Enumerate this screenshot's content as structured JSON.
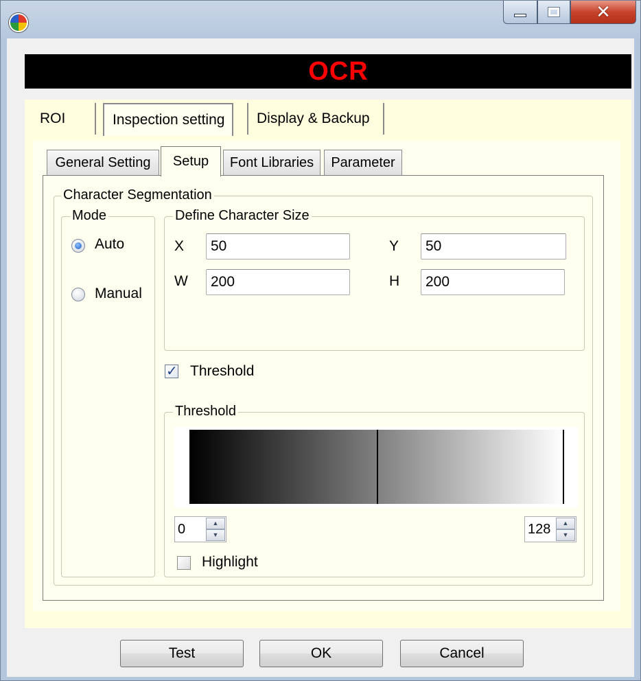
{
  "header": {
    "title": "OCR"
  },
  "top_tabs": [
    {
      "label": "ROI"
    },
    {
      "label": "Inspection setting"
    },
    {
      "label": "Display & Backup"
    }
  ],
  "sub_tabs": [
    {
      "label": "General Setting"
    },
    {
      "label": "Setup"
    },
    {
      "label": "Font Libraries"
    },
    {
      "label": "Parameter"
    }
  ],
  "segmentation": {
    "title": "Character Segmentation",
    "mode": {
      "title": "Mode",
      "options": [
        {
          "label": "Auto",
          "checked": true
        },
        {
          "label": "Manual",
          "checked": false
        }
      ]
    },
    "size": {
      "title": "Define Character Size",
      "x_label": "X",
      "x_value": "50",
      "y_label": "Y",
      "y_value": "50",
      "w_label": "W",
      "w_value": "200",
      "h_label": "H",
      "h_value": "200"
    },
    "threshold_checkbox": {
      "label": "Threshold",
      "checked": true
    },
    "threshold_group": {
      "title": "Threshold",
      "min_value": "0",
      "max_value": "128",
      "marker_fraction": 0.5,
      "highlight": {
        "label": "Highlight",
        "checked": false
      }
    }
  },
  "buttons": {
    "test": "Test",
    "ok": "OK",
    "cancel": "Cancel"
  },
  "colors": {
    "title_text": "#ff0000",
    "title_background": "#000000",
    "panel_background": "#ffffe0"
  },
  "icons": {
    "app": "app-icon",
    "minimize": "minimize-icon",
    "maximize": "maximize-icon",
    "close": "close-icon"
  }
}
